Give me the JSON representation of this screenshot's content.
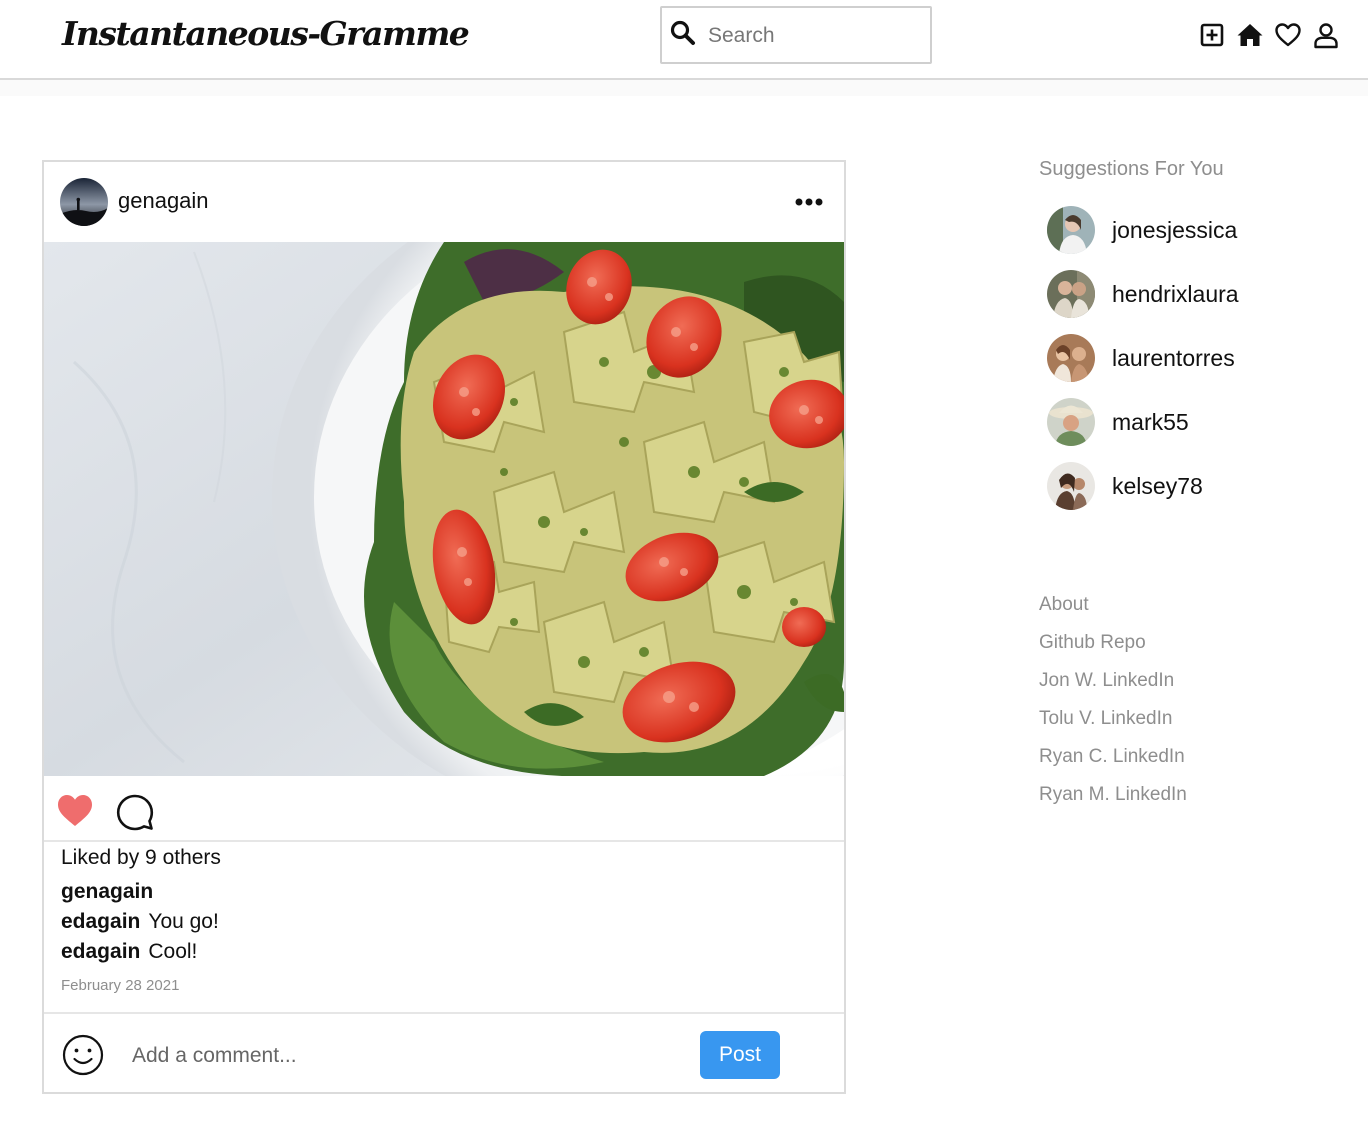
{
  "header": {
    "logo": "Instantaneous-Gramme",
    "search": {
      "placeholder": "Search",
      "value": ""
    },
    "icons": [
      "add-post-icon",
      "home-icon",
      "heart-icon",
      "profile-icon"
    ]
  },
  "post": {
    "username": "genagain",
    "image_subject": "pasta-salad-photo",
    "liked": true,
    "like_color": "#ef6d6d",
    "likes_text": "Liked by 9 others",
    "caption_username": "genagain",
    "comments": [
      {
        "username": "edagain",
        "text": "You go!"
      },
      {
        "username": "edagain",
        "text": "Cool!"
      }
    ],
    "date": "February 28 2021",
    "comment_input": {
      "placeholder": "Add a comment...",
      "value": ""
    },
    "post_button_label": "Post",
    "post_button_color": "#3897f0"
  },
  "sidebar": {
    "suggestions_title": "Suggestions For You",
    "suggestions": [
      {
        "username": "jonesjessica"
      },
      {
        "username": "hendrixlaura"
      },
      {
        "username": "laurentorres"
      },
      {
        "username": "mark55"
      },
      {
        "username": "kelsey78"
      }
    ],
    "footer_links": [
      "About",
      "Github Repo",
      "Jon W. LinkedIn",
      "Tolu V. LinkedIn",
      "Ryan C. LinkedIn",
      "Ryan M. LinkedIn"
    ]
  }
}
